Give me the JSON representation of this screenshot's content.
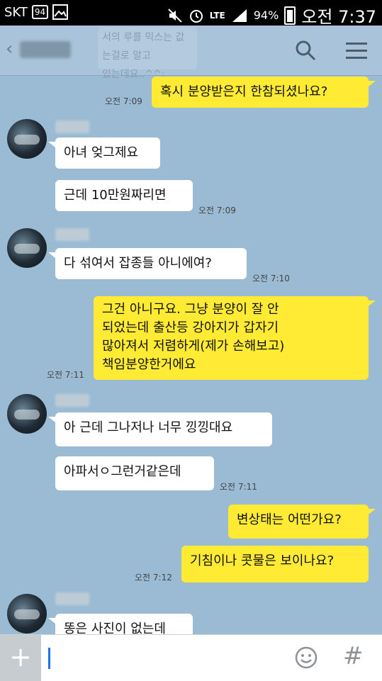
{
  "status": {
    "carrier": "SKT",
    "notif_badge": "94",
    "network": "LTE",
    "battery": "94%",
    "time": "오전 7:37"
  },
  "header": {
    "faded_preview": "서의 루를 믹스는 값는걸로 알고\n있는데요..^^;"
  },
  "messages": {
    "m1": {
      "text": "혹시 분양받은지 한참되셨나요?",
      "time": "오전 7:09"
    },
    "m2": {
      "text": "아녀 엊그제요"
    },
    "m3": {
      "text": "근데 10만원짜리면",
      "time": "오전 7:09"
    },
    "m4": {
      "text": "다 섞여서 잡종들 아니에여?",
      "time": "오전 7:10"
    },
    "m5": {
      "text": "그건 아니구요. 그냥 분양이 잘 안\n되었는데 출산등 강아지가 갑자기\n많아져서 저렴하게(제가 손해보고)\n책임분양한거에요",
      "time": "오전 7:11"
    },
    "m6": {
      "text": "아 근데 그나저나 너무 낑낑대요"
    },
    "m7": {
      "text": "아파서ㅇ그런거같은데",
      "time": "오전 7:11"
    },
    "m8": {
      "text": "변상태는 어떤가요?"
    },
    "m9": {
      "text": "기침이나 콧물은 보이나요?",
      "time": "오전 7:12"
    },
    "m10": {
      "text": "똥은 사진이 없는데"
    }
  },
  "input": {
    "plus": "+",
    "hash": "#"
  },
  "colors": {
    "chat_bg": "#9bbbd4",
    "outgoing": "#ffeb33",
    "incoming": "#ffffff"
  }
}
